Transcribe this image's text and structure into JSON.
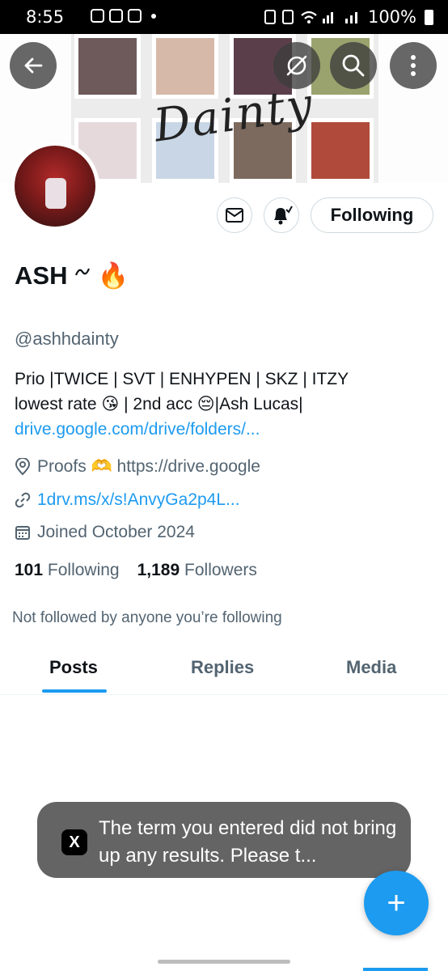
{
  "status_bar": {
    "time": "8:55",
    "battery": "100%"
  },
  "banner": {
    "text": "Dainty"
  },
  "header_buttons": {
    "back_icon": "arrow-left-icon",
    "translate_icon": "slash-circle-icon",
    "search_icon": "search-icon",
    "more_icon": "more-vertical-icon"
  },
  "profile": {
    "name": "ASH",
    "name_emoji": "🔥",
    "handle": "@ashhdainty",
    "bio_line1": "Prio |TWICE | SVT | ENHYPEN | SKZ | ITZY",
    "bio_line2": "lowest rate 😘 | 2nd acc 😔|Ash Lucas|",
    "bio_link": "drive.google.com/drive/folders/...",
    "location": "Proofs 🫶 https://drive.google",
    "website": "1drv.ms/x/s!AnvyGa2p4L...",
    "joined": "Joined October 2024",
    "following_count": "101",
    "following_label": "Following",
    "followers_count": "1,189",
    "followers_label": "Followers",
    "not_followed": "Not followed by anyone you’re following"
  },
  "actions": {
    "following_button": "Following"
  },
  "tabs": [
    {
      "label": "Posts",
      "active": true
    },
    {
      "label": "Replies",
      "active": false
    },
    {
      "label": "Media",
      "active": false
    }
  ],
  "toast": {
    "logo": "X",
    "message": "The term you entered did not bring up any results. Please t..."
  },
  "fab": {
    "label": "+"
  },
  "colors": {
    "accent": "#1d9bf0",
    "secondary_text": "#536471",
    "primary_text": "#0f1419"
  }
}
